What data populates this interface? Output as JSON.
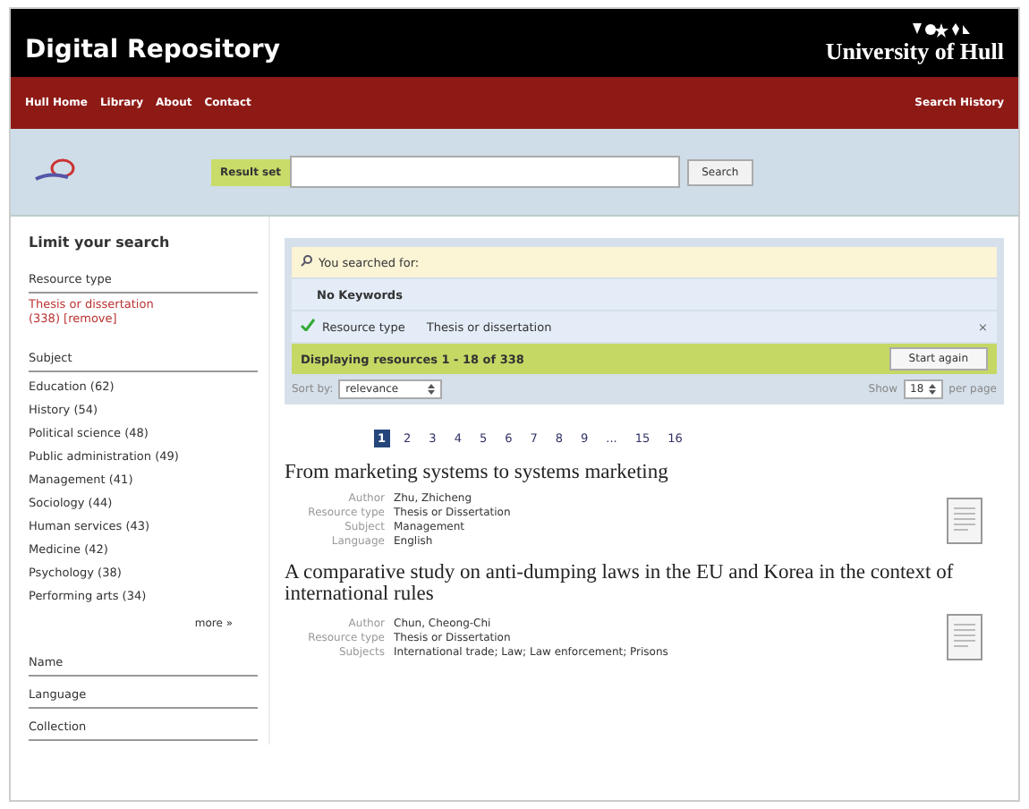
{
  "header": {
    "title": "Digital Repository",
    "university": "University of Hull"
  },
  "nav": {
    "links": [
      "Hull Home",
      "Library",
      "About",
      "Contact"
    ],
    "right_link": "Search History"
  },
  "search": {
    "label": "Result set",
    "button": "Search"
  },
  "sidebar": {
    "title": "Limit your search",
    "facets": [
      {
        "title": "Resource type",
        "items": [
          {
            "label": "Thesis or dissertation (338)",
            "remove": "[remove]",
            "selected": true
          }
        ]
      },
      {
        "title": "Subject",
        "items": [
          {
            "label": "Education (62)",
            "selected": false
          },
          {
            "label": "History (54)",
            "selected": false
          },
          {
            "label": "Political science (48)",
            "selected": false
          },
          {
            "label": "Public administration (49)",
            "selected": false
          },
          {
            "label": "Management (41)",
            "selected": false
          },
          {
            "label": "Sociology (44)",
            "selected": false
          },
          {
            "label": "Human services (43)",
            "selected": false
          },
          {
            "label": "Medicine (42)",
            "selected": false
          },
          {
            "label": "Psychology (38)",
            "selected": false
          },
          {
            "label": "Performing arts (34)",
            "selected": false
          }
        ],
        "more": "more »"
      },
      {
        "title": "Name"
      },
      {
        "title": "Language"
      },
      {
        "title": "Collection"
      }
    ]
  },
  "query": {
    "heading": "You searched for:",
    "keywords": "No Keywords",
    "filters": [
      {
        "label": "Resource type",
        "value": "Thesis or dissertation",
        "remove": "×"
      }
    ],
    "status": "Displaying resources 1 - 18 of 338",
    "start_again": "Start again",
    "sort_label": "Sort by:",
    "sort_value": "relevance",
    "show_label": "Show",
    "show_value": "18",
    "per_page": "per page"
  },
  "pagination": [
    {
      "label": "1",
      "selected": true
    },
    {
      "label": "2",
      "selected": false
    },
    {
      "label": "3",
      "selected": false
    },
    {
      "label": "4",
      "selected": false
    },
    {
      "label": "5",
      "selected": false
    },
    {
      "label": "6",
      "selected": false
    },
    {
      "label": "7",
      "selected": false
    },
    {
      "label": "8",
      "selected": false
    },
    {
      "label": "9",
      "selected": false
    },
    {
      "label": "...",
      "selected": false
    },
    {
      "label": "15",
      "selected": false
    },
    {
      "label": "16",
      "selected": false
    }
  ],
  "results": [
    {
      "title": "From marketing systems to systems marketing",
      "fields": [
        {
          "label": "Author",
          "value": "Zhu, Zhicheng"
        },
        {
          "label": "Resource type",
          "value": "Thesis or Dissertation"
        },
        {
          "label": "Subject",
          "value": "Management"
        },
        {
          "label": "Language",
          "value": "English"
        }
      ]
    },
    {
      "title": "A comparative study on anti-dumping laws in the EU and Korea in the context of international rules",
      "fields": [
        {
          "label": "Author",
          "value": "Chun, Cheong-Chi"
        },
        {
          "label": "Resource type",
          "value": "Thesis or Dissertation"
        },
        {
          "label": "Subjects",
          "value": "International trade; Law; Law enforcement; Prisons"
        }
      ]
    }
  ]
}
